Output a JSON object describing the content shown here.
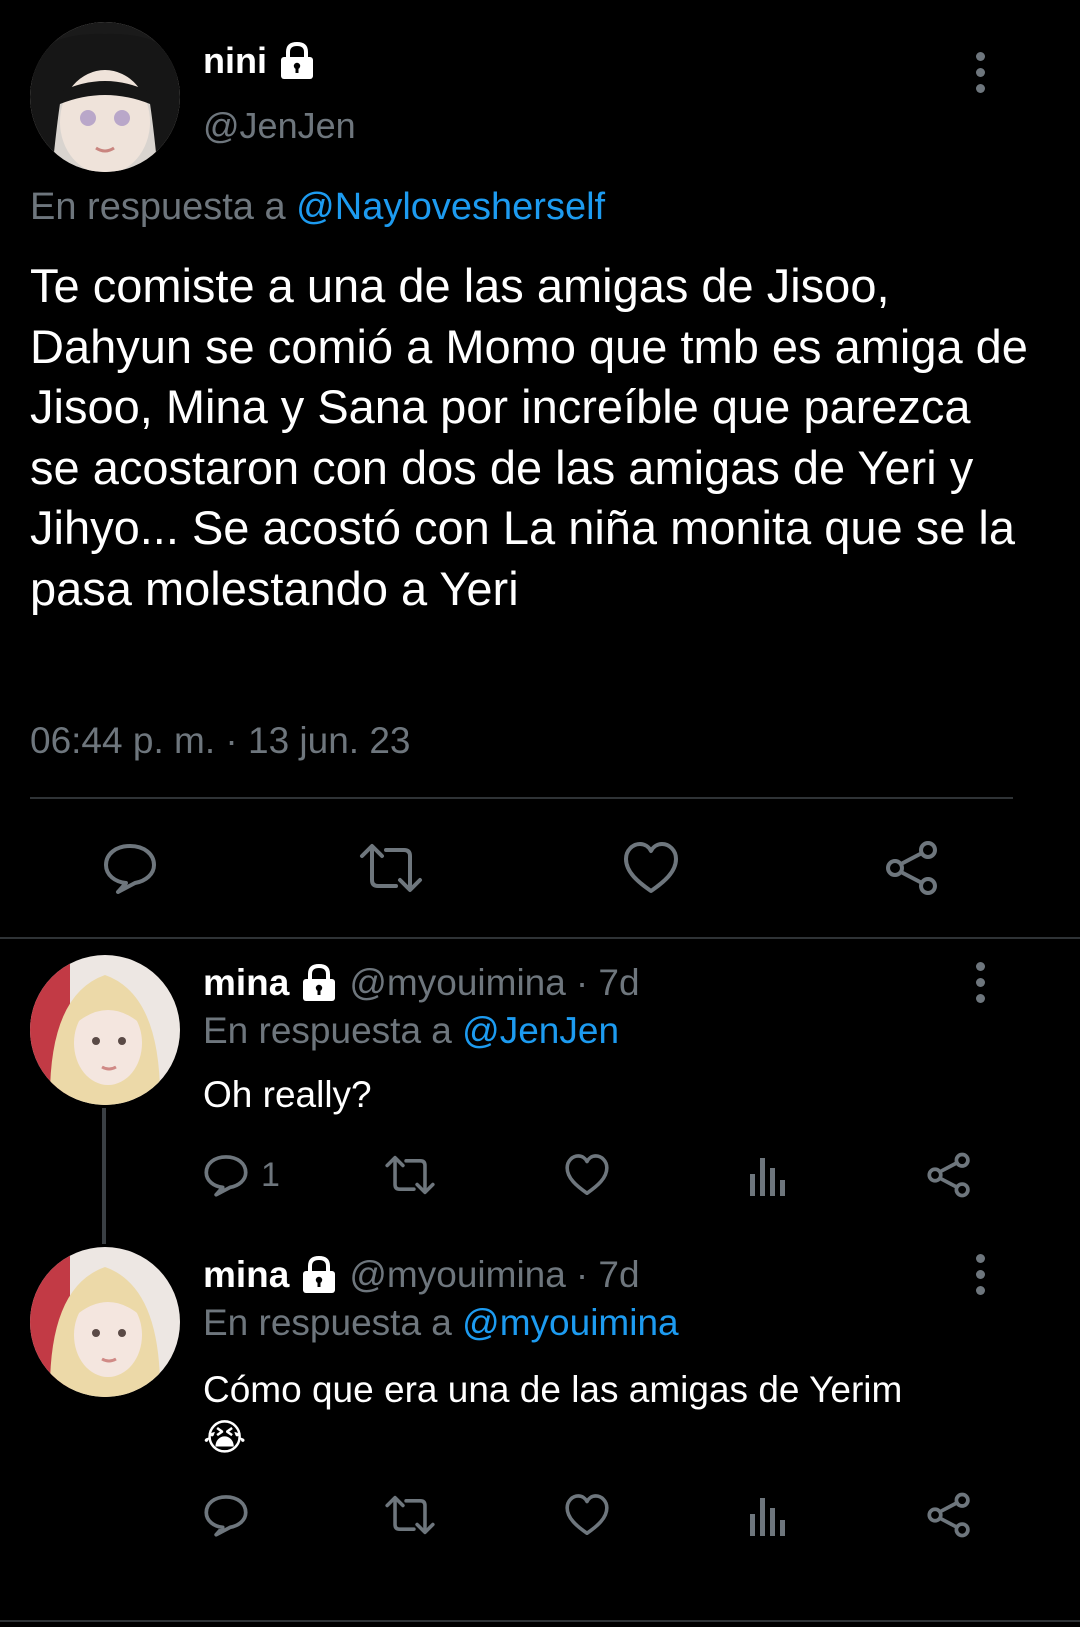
{
  "main_tweet": {
    "display_name": "nini",
    "handle": "@JenJen",
    "reply_prefix": "En respuesta a",
    "reply_to": "@Naylovesherself",
    "text": "Te comiste a una de las amigas de Jisoo, Dahyun se comió a Momo que tmb es amiga de Jisoo, Mina y Sana por increíble que parezca se acostaron con dos de las amigas de Yeri y Jihyo... Se acostó con La niña monita que se la pasa molestando a Yeri",
    "timestamp": "06:44 p. m. · 13 jun. 23",
    "actions": [
      "reply-icon",
      "retweet-icon",
      "like-icon",
      "share-icon"
    ]
  },
  "replies": [
    {
      "display_name": "mina",
      "handle": "@myouimina",
      "time": "· 7d",
      "reply_prefix": "En respuesta a",
      "reply_to": "@JenJen",
      "text": "Oh really?",
      "emoji": "",
      "reply_count": "1"
    },
    {
      "display_name": "mina",
      "handle": "@myouimina",
      "time": "· 7d",
      "reply_prefix": "En respuesta a",
      "reply_to": "@myouimina",
      "text": "Cómo que era una de las amigas de Yerim",
      "emoji": "😭",
      "reply_count": ""
    }
  ],
  "colors": {
    "background": "#000000",
    "text": "#ffffff",
    "secondary": "#6e767d",
    "link": "#1d9bf0",
    "divider": "#2f3336"
  }
}
